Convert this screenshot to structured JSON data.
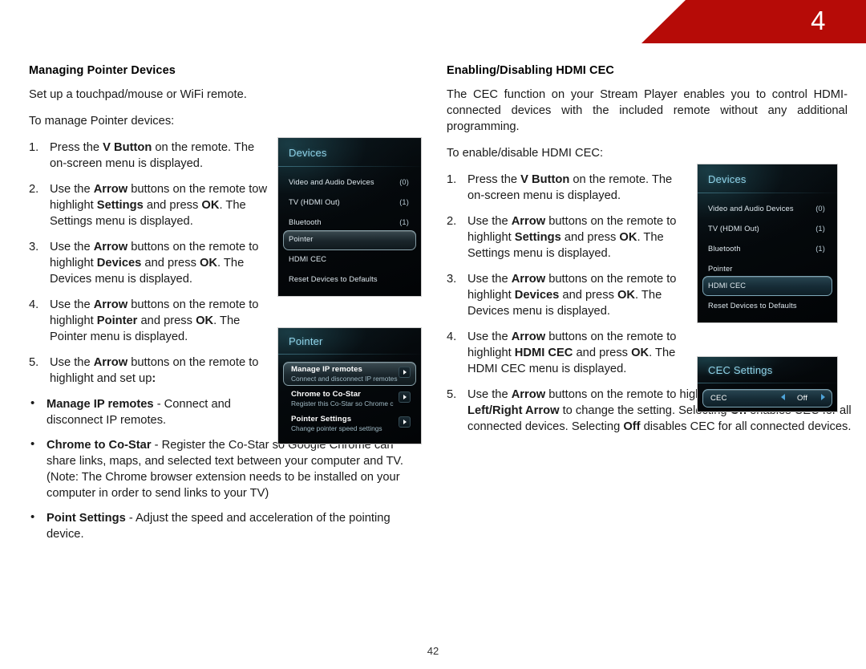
{
  "header": {
    "chapter_number": "4",
    "banner_color": "#b60b07"
  },
  "footer": {
    "page_number": "42"
  },
  "left_column": {
    "section_title": "Managing Pointer Devices",
    "intro": "Set up a touchpad/mouse or WiFi remote.",
    "lead_in": "To manage Pointer devices:",
    "steps": [
      {
        "num": "1.",
        "parts": [
          {
            "t": "Press the ",
            "b": false
          },
          {
            "t": "V Button",
            "b": true
          },
          {
            "t": " on the remote. The on-screen menu is displayed.",
            "b": false
          }
        ]
      },
      {
        "num": "2.",
        "parts": [
          {
            "t": "Use the ",
            "b": false
          },
          {
            "t": "Arrow",
            "b": true
          },
          {
            "t": " buttons on the remote tow highlight ",
            "b": false
          },
          {
            "t": "Settings",
            "b": true
          },
          {
            "t": " and press ",
            "b": false
          },
          {
            "t": "OK",
            "b": true
          },
          {
            "t": ". The Settings menu is displayed.",
            "b": false
          }
        ]
      },
      {
        "num": "3.",
        "parts": [
          {
            "t": "Use the ",
            "b": false
          },
          {
            "t": "Arrow",
            "b": true
          },
          {
            "t": " buttons on the remote to highlight ",
            "b": false
          },
          {
            "t": "Devices",
            "b": true
          },
          {
            "t": " and press ",
            "b": false
          },
          {
            "t": "OK",
            "b": true
          },
          {
            "t": ". The Devices menu is displayed.",
            "b": false
          }
        ]
      },
      {
        "num": "4.",
        "parts": [
          {
            "t": "Use the ",
            "b": false
          },
          {
            "t": "Arrow",
            "b": true
          },
          {
            "t": " buttons on the remote to highlight ",
            "b": false
          },
          {
            "t": "Pointer",
            "b": true
          },
          {
            "t": " and press ",
            "b": false
          },
          {
            "t": "OK",
            "b": true
          },
          {
            "t": ". The Pointer menu is displayed.",
            "b": false
          }
        ]
      },
      {
        "num": "5.",
        "parts": [
          {
            "t": "Use the ",
            "b": false
          },
          {
            "t": "Arrow",
            "b": true
          },
          {
            "t": " buttons on the remote to highlight and set up",
            "b": false
          },
          {
            "t": ":",
            "b": true
          }
        ]
      }
    ],
    "bullets": [
      {
        "parts": [
          {
            "t": "Manage IP remotes",
            "b": true
          },
          {
            "t": " - Connect and disconnect IP remotes.",
            "b": false
          }
        ]
      },
      {
        "parts": [
          {
            "t": "Chrome to Co-Star",
            "b": true
          },
          {
            "t": " - Register the Co-Star so Google Chrome can share links, maps, and selected text between your computer and TV. (Note: The Chrome browser extension needs to be installed on your computer in order to send links to your TV)",
            "b": false
          }
        ]
      },
      {
        "parts": [
          {
            "t": "Point Settings",
            "b": true
          },
          {
            "t": " - Adjust the speed and acceleration of the pointing device.",
            "b": false
          }
        ]
      }
    ]
  },
  "right_column": {
    "section_title": "Enabling/Disabling HDMI CEC",
    "intro": "The CEC function on your Stream Player enables you to control HDMI-connected devices with the included remote without any additional programming.",
    "lead_in": "To enable/disable HDMI CEC:",
    "steps": [
      {
        "num": "1.",
        "parts": [
          {
            "t": "Press the ",
            "b": false
          },
          {
            "t": "V Button",
            "b": true
          },
          {
            "t": " on the remote. The on-screen menu is displayed.",
            "b": false
          }
        ]
      },
      {
        "num": "2.",
        "parts": [
          {
            "t": "Use the ",
            "b": false
          },
          {
            "t": "Arrow",
            "b": true
          },
          {
            "t": " buttons on the remote to highlight ",
            "b": false
          },
          {
            "t": "Settings",
            "b": true
          },
          {
            "t": " and press ",
            "b": false
          },
          {
            "t": "OK",
            "b": true
          },
          {
            "t": ". The Settings menu is displayed.",
            "b": false
          }
        ]
      },
      {
        "num": "3.",
        "parts": [
          {
            "t": "Use the ",
            "b": false
          },
          {
            "t": "Arrow",
            "b": true
          },
          {
            "t": " buttons on the remote to highlight ",
            "b": false
          },
          {
            "t": "Devices",
            "b": true
          },
          {
            "t": " and press ",
            "b": false
          },
          {
            "t": "OK",
            "b": true
          },
          {
            "t": ". The Devices menu is displayed.",
            "b": false
          }
        ]
      },
      {
        "num": "4.",
        "parts": [
          {
            "t": "Use the ",
            "b": false
          },
          {
            "t": "Arrow",
            "b": true
          },
          {
            "t": " buttons on the remote to highlight ",
            "b": false
          },
          {
            "t": "HDMI CEC",
            "b": true
          },
          {
            "t": " and press ",
            "b": false
          },
          {
            "t": "OK",
            "b": true
          },
          {
            "t": ". The HDMI CEC menu is displayed.",
            "b": false
          }
        ]
      },
      {
        "num": "5.",
        "parts": [
          {
            "t": "Use the ",
            "b": false
          },
          {
            "t": "Arrow",
            "b": true
          },
          {
            "t": " buttons on the remote to highlight ",
            "b": false
          },
          {
            "t": "CEC",
            "b": true
          },
          {
            "t": " and use the ",
            "b": false
          },
          {
            "t": "Left/Right Arrow",
            "b": true
          },
          {
            "t": " to change the setting. Selecting ",
            "b": false
          },
          {
            "t": "On",
            "b": true
          },
          {
            "t": " enables CEC for all connected devices. Selecting ",
            "b": false
          },
          {
            "t": "Off",
            "b": true
          },
          {
            "t": " disables CEC for all connected devices.",
            "b": false
          }
        ]
      }
    ]
  },
  "osd_screens": {
    "devices_pointer": {
      "title": "Devices",
      "highlighted": "Pointer",
      "rows": [
        {
          "label": "Video and Audio Devices",
          "count": "(0)"
        },
        {
          "label": "TV (HDMI Out)",
          "count": "(1)"
        },
        {
          "label": "Bluetooth",
          "count": "(1)"
        },
        {
          "label": "Pointer",
          "count": ""
        },
        {
          "label": "HDMI CEC",
          "count": ""
        },
        {
          "label": "Reset Devices to Defaults",
          "count": ""
        }
      ]
    },
    "pointer_menu": {
      "title": "Pointer",
      "highlighted": "Manage IP remotes",
      "rows": [
        {
          "label": "Manage IP remotes",
          "sub": "Connect and disconnect IP remotes",
          "arrow": "chevron-right-icon"
        },
        {
          "label": "Chrome to Co-Star",
          "sub": "Register this Co-Star so Chrome c",
          "arrow": "chevron-right-icon"
        },
        {
          "label": "Pointer Settings",
          "sub": "Change pointer speed settings",
          "arrow": "chevron-right-icon"
        }
      ]
    },
    "devices_cec": {
      "title": "Devices",
      "highlighted": "HDMI CEC",
      "rows": [
        {
          "label": "Video and Audio Devices",
          "count": "(0)"
        },
        {
          "label": "TV (HDMI Out)",
          "count": "(1)"
        },
        {
          "label": "Bluetooth",
          "count": "(1)"
        },
        {
          "label": "Pointer",
          "count": ""
        },
        {
          "label": "HDMI CEC",
          "count": ""
        },
        {
          "label": "Reset Devices to Defaults",
          "count": ""
        }
      ]
    },
    "cec_settings": {
      "title": "CEC Settings",
      "row_label": "CEC",
      "row_value": "Off",
      "left_arrow": "triangle-left-icon",
      "right_arrow": "triangle-right-icon"
    }
  }
}
